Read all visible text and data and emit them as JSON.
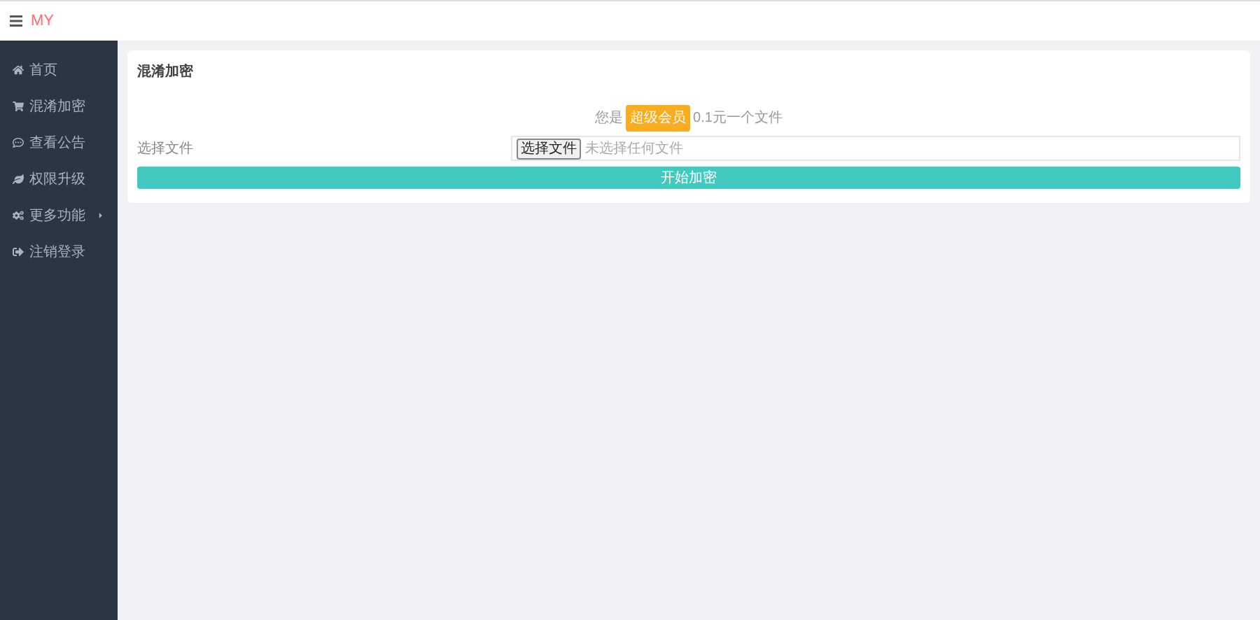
{
  "header": {
    "logo": "MY"
  },
  "sidebar": {
    "items": [
      {
        "kind": "home",
        "label": "首页",
        "has_arrow": false
      },
      {
        "kind": "cart",
        "label": "混淆加密",
        "has_arrow": false
      },
      {
        "kind": "chat",
        "label": "查看公告",
        "has_arrow": false
      },
      {
        "kind": "leaf",
        "label": "权限升级",
        "has_arrow": false
      },
      {
        "kind": "gears",
        "label": "更多功能",
        "has_arrow": true
      },
      {
        "kind": "logout",
        "label": "注销登录",
        "has_arrow": false
      }
    ]
  },
  "panel": {
    "title": "混淆加密",
    "notice": {
      "prefix": "您是",
      "badge": "超级会员",
      "suffix": "0.1元一个文件"
    },
    "file_label": "选择文件",
    "file_button": "选择文件",
    "file_status": "未选择任何文件",
    "submit": "开始加密"
  }
}
